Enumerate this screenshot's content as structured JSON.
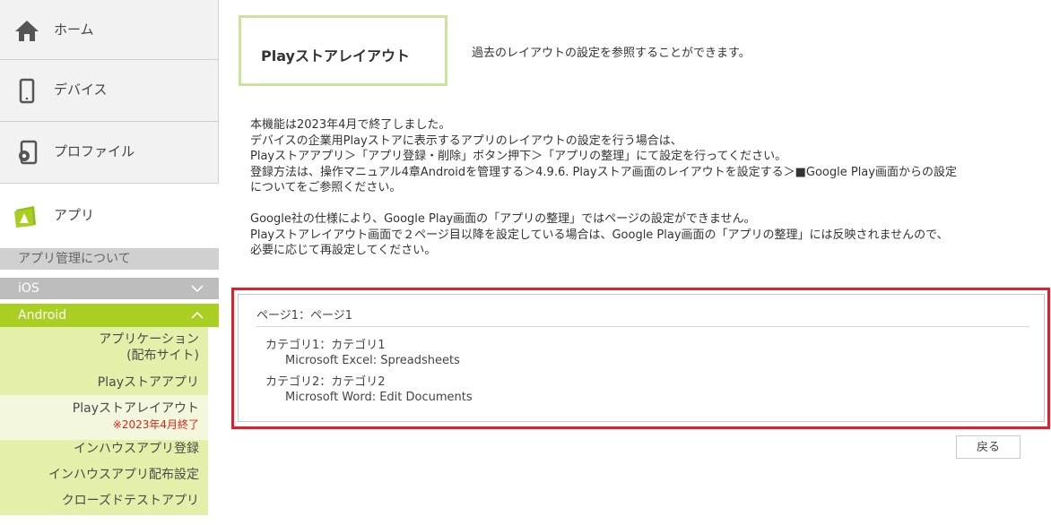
{
  "sidebar": {
    "home_label": "ホーム",
    "device_label": "デバイス",
    "profile_label": "プロファイル",
    "app_label": "アプリ",
    "about_label": "アプリ管理について",
    "ios_label": "iOS",
    "android_label": "Android",
    "android_items": [
      {
        "label": "アプリケーション",
        "label2": "(配布サイト)"
      },
      {
        "label": "Playストアアプリ"
      },
      {
        "label": "Playストアレイアウト",
        "note": "※2023年4月終了"
      },
      {
        "label": "インハウスアプリ登録"
      },
      {
        "label": "インハウスアプリ配布設定"
      },
      {
        "label": "クローズドテストアプリ"
      }
    ]
  },
  "main": {
    "title": "Playストアレイアウト",
    "title_desc": "過去のレイアウトの設定を参照することができます。",
    "notice_lines": [
      "本機能は2023年4月で終了しました。",
      "デバイスの企業用Playストアに表示するアプリのレイアウトの設定を行う場合は、",
      "Playストアアプリ＞「アプリ登録・削除」ボタン押下＞「アプリの整理」にて設定を行ってください。",
      "登録方法は、操作マニュアル4章Androidを管理する＞4.9.6. Playストア画面のレイアウトを設定する＞■Google Play画面からの設定",
      "についてをご参照ください。",
      "Google社の仕様により、Google Play画面の「アプリの整理」ではページの設定ができません。",
      "Playストアレイアウト画面で２ページ目以降を設定している場合は、Google Play画面の「アプリの整理」には反映されませんので、",
      "必要に応じて再設定してください。"
    ],
    "layout": {
      "page": "ページ1：ページ1",
      "categories": [
        {
          "name": "カテゴリ1：カテゴリ1",
          "app": "Microsoft Excel: Spreadsheets"
        },
        {
          "name": "カテゴリ2：カテゴリ2",
          "app": "Microsoft Word: Edit Documents"
        }
      ]
    },
    "back_label": "戻る"
  },
  "colors": {
    "android_green": "#a8cf21",
    "submenu_bg": "#e4efaa",
    "highlight_red": "#e0202a",
    "title_border": "#cde39a",
    "note_red": "#dd2222"
  }
}
